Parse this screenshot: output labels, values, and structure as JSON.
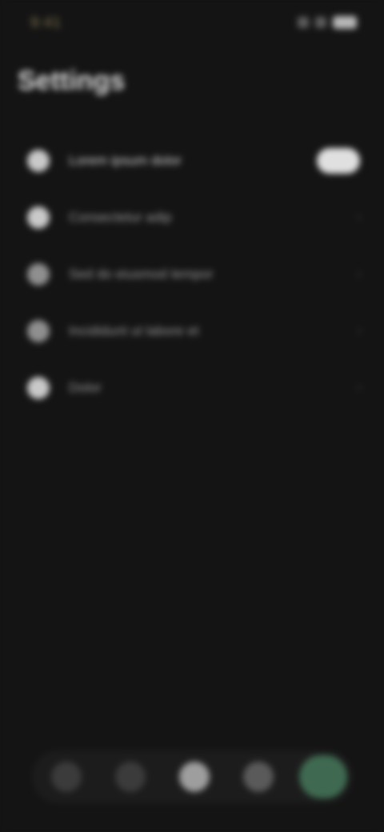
{
  "status_bar": {
    "time": "9:41",
    "battery_icon": "battery-icon",
    "signal_icon": "signal-icon",
    "accent": "#8a7a55"
  },
  "page": {
    "title": "Settings"
  },
  "settings": {
    "items": [
      {
        "label": "Lorem ipsum dolor",
        "icon": "circle-icon",
        "control": "toggle",
        "toggle_on": true
      },
      {
        "label": "Consectetur adip",
        "icon": "circle-icon",
        "control": "chevron"
      },
      {
        "label": "Sed do eiusmod tempor",
        "icon": "circle-icon",
        "control": "chevron"
      },
      {
        "label": "Incididunt ut labore et",
        "icon": "circle-icon",
        "control": "chevron"
      },
      {
        "label": "Dolor",
        "icon": "circle-icon",
        "control": "chevron"
      }
    ],
    "chevron_glyph": "›"
  },
  "bottom_nav": {
    "items": [
      {
        "icon": "nav-icon-1"
      },
      {
        "icon": "nav-icon-2"
      },
      {
        "icon": "nav-icon-3"
      },
      {
        "icon": "nav-icon-4"
      },
      {
        "icon": "nav-icon-5",
        "active": true,
        "accent": "#3f6a51"
      }
    ]
  }
}
